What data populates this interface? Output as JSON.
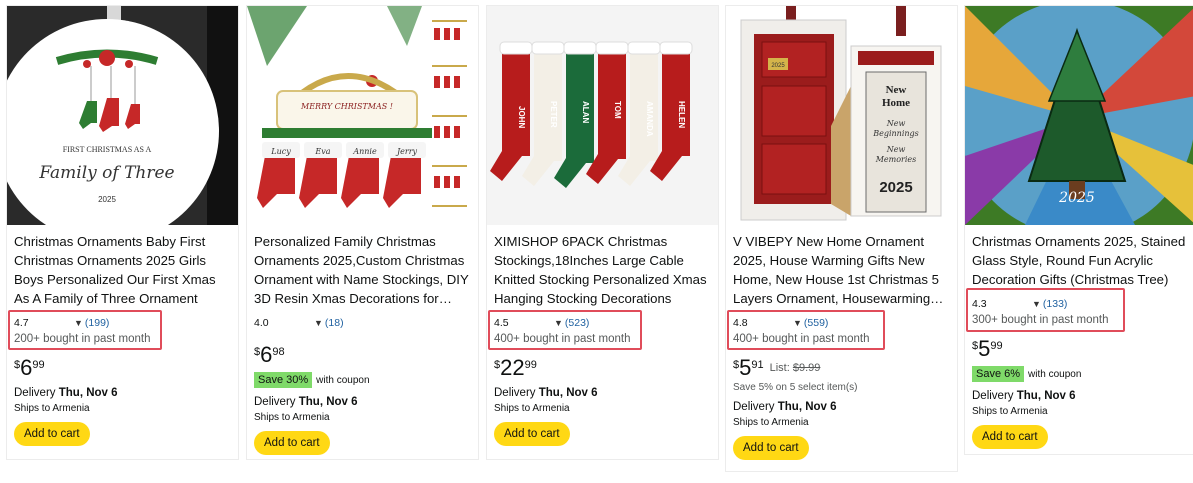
{
  "products": [
    {
      "title": "Christmas Ornaments Baby First Christmas Ornaments 2025 Girls Boys Personalized Our First Xmas As A Family of Three Ornament New…",
      "rating": "4.7",
      "reviews": "(199)",
      "bought": "200+ bought in past month",
      "price_currency": "$",
      "price_whole": "6",
      "price_frac": "99",
      "delivery_prefix": "Delivery",
      "delivery_date": "Thu, Nov 6",
      "ships": "Ships to Armenia",
      "cart": "Add to cart",
      "image_text": {
        "line1": "FIRST CHRISTMAS AS A",
        "line2": "Family of Three",
        "line3": "2025"
      }
    },
    {
      "title": "Personalized Family Christmas Ornaments 2025,Custom Christmas Ornament with Name Stockings, DIY 3D Resin Xmas Decorations for…",
      "rating": "4.0",
      "reviews": "(18)",
      "price_currency": "$",
      "price_whole": "6",
      "price_frac": "98",
      "coupon_badge": "Save 30%",
      "coupon_text": "with coupon",
      "delivery_prefix": "Delivery",
      "delivery_date": "Thu, Nov 6",
      "ships": "Ships to Armenia",
      "cart": "Add to cart",
      "image_text": {
        "banner": "MERRY CHRISTMAS !",
        "n1": "Lucy",
        "n2": "Eva",
        "n3": "Annie",
        "n4": "Jerry"
      }
    },
    {
      "title": "XIMISHOP 6PACK Christmas Stockings,18Inches Large Cable Knitted Stocking Personalized Xmas Hanging Stocking Decorations with…",
      "rating": "4.5",
      "reviews": "(523)",
      "bought": "400+ bought in past month",
      "price_currency": "$",
      "price_whole": "22",
      "price_frac": "99",
      "delivery_prefix": "Delivery",
      "delivery_date": "Thu, Nov 6",
      "ships": "Ships to Armenia",
      "cart": "Add to cart",
      "image_text": {
        "n1": "JOHN",
        "n2": "PETER",
        "n3": "ALAN",
        "n4": "TOM",
        "n5": "AMANDA",
        "n6": "HELEN"
      }
    },
    {
      "title": "V VIBEPY New Home Ornament 2025, House Warming Gifts New Home, New House 1st Christmas 5 Layers Ornament, Housewarming…",
      "rating": "4.8",
      "reviews": "(559)",
      "bought": "400+ bought in past month",
      "price_currency": "$",
      "price_whole": "5",
      "price_frac": "91",
      "list_label": "List:",
      "list_price": "$9.99",
      "save_note": "Save 5% on 5 select item(s)",
      "delivery_prefix": "Delivery",
      "delivery_date": "Thu, Nov 6",
      "ships": "Ships to Armenia",
      "cart": "Add to cart",
      "image_text": {
        "year_small": "2025",
        "line1": "New",
        "line2": "Home",
        "line3": "New",
        "line4": "Beginnings",
        "line5": "New",
        "line6": "Memories",
        "year": "2025"
      }
    },
    {
      "title": "Christmas Ornaments 2025, Stained Glass Style, Round Fun Acrylic Decoration Gifts (Christmas Tree)",
      "rating": "4.3",
      "reviews": "(133)",
      "bought": "300+ bought in past month",
      "price_currency": "$",
      "price_whole": "5",
      "price_frac": "99",
      "coupon_badge": "Save 6%",
      "coupon_text": "with coupon",
      "delivery_prefix": "Delivery",
      "delivery_date": "Thu, Nov 6",
      "ships": "Ships to Armenia",
      "cart": "Add to cart",
      "image_text": {
        "year": "2025"
      }
    }
  ],
  "colors": {
    "highlight": "#e04c5a",
    "cart": "#ffd814",
    "coupon": "#7fda69",
    "link": "#2162a1"
  }
}
